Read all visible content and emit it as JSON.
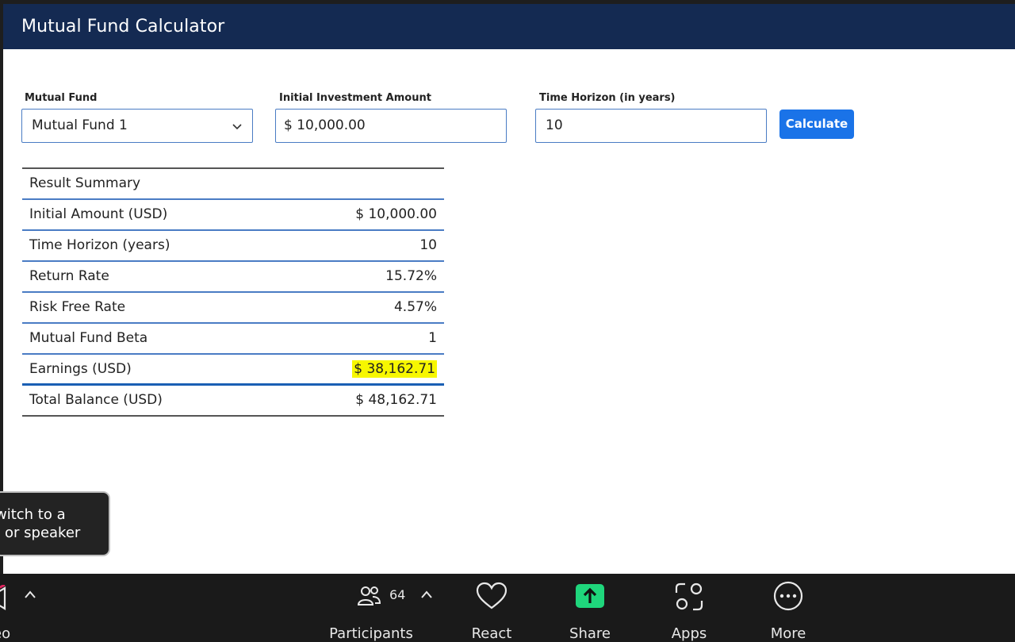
{
  "app": {
    "title": "Mutual Fund Calculator"
  },
  "form": {
    "fund_label": "Mutual Fund",
    "fund_value": "Mutual Fund 1",
    "amount_label": "Initial Investment Amount",
    "amount_value": "$ 10,000.00",
    "horizon_label": "Time Horizon (in years)",
    "horizon_value": "10",
    "calculate_label": "Calculate"
  },
  "summary": {
    "title": "Result Summary",
    "rows": [
      {
        "label": "Initial Amount (USD)",
        "value": "$ 10,000.00"
      },
      {
        "label": "Time Horizon (years)",
        "value": "10"
      },
      {
        "label": "Return Rate",
        "value": "15.72%"
      },
      {
        "label": "Risk Free Rate",
        "value": "4.57%"
      },
      {
        "label": "Mutual Fund Beta",
        "value": "1"
      },
      {
        "label": "Earnings (USD)",
        "value": "$ 38,162.71"
      },
      {
        "label": "Total Balance (USD)",
        "value": "$ 48,162.71"
      }
    ],
    "highlight_color": "#f7f700"
  },
  "toast": {
    "line1": "witch to a",
    "line2": "or speaker"
  },
  "toolbar": {
    "video_label": "eo",
    "participants_label": "Participants",
    "participants_count": "64",
    "react_label": "React",
    "share_label": "Share",
    "apps_label": "Apps",
    "more_label": "More",
    "share_color": "#1fd67c"
  },
  "colors": {
    "header": "#142a52",
    "accent": "#1a73e8",
    "row_border": "#4a7cc4"
  }
}
